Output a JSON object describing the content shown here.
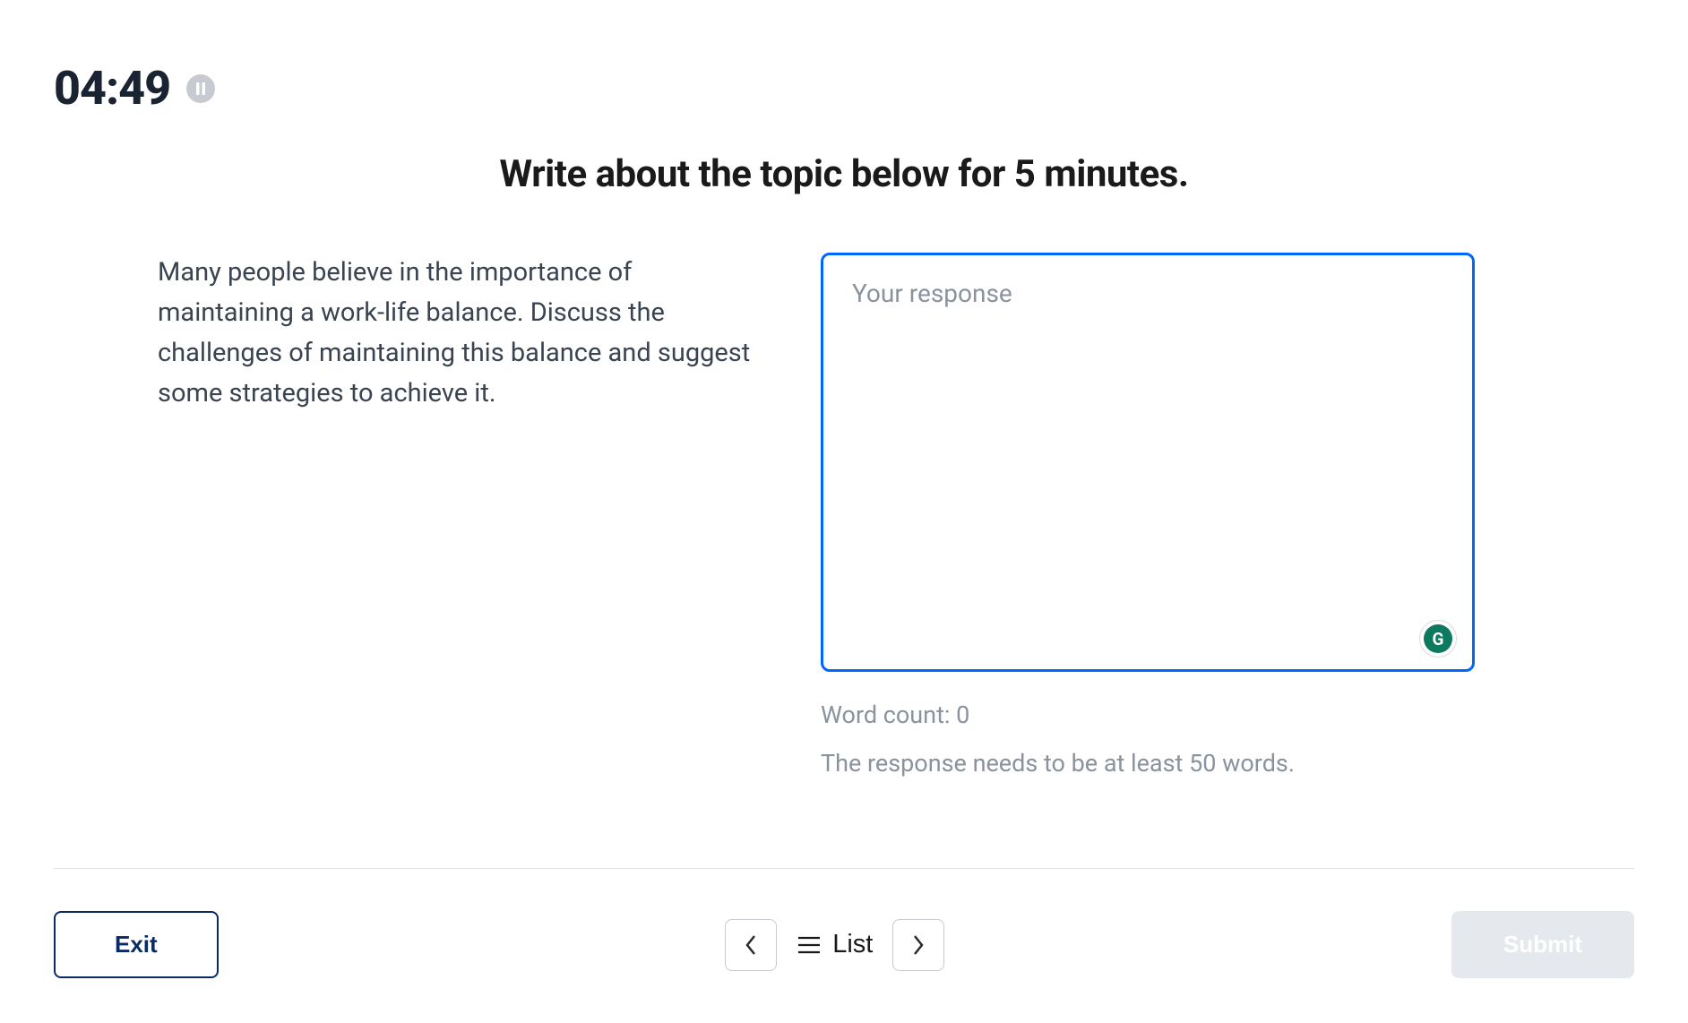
{
  "timer": {
    "display": "04:49"
  },
  "instruction": "Write about the topic below for 5 minutes.",
  "prompt": "Many people believe in the importance of maintaining a work-life balance. Discuss the challenges of maintaining this balance and suggest some strategies to achieve it.",
  "response": {
    "placeholder": "Your response",
    "value": "",
    "word_count_label": "Word count: 0",
    "min_words_message": "The response needs to be at least 50 words."
  },
  "grammarly": {
    "letter": "G"
  },
  "footer": {
    "exit_label": "Exit",
    "list_label": "List",
    "submit_label": "Submit"
  }
}
